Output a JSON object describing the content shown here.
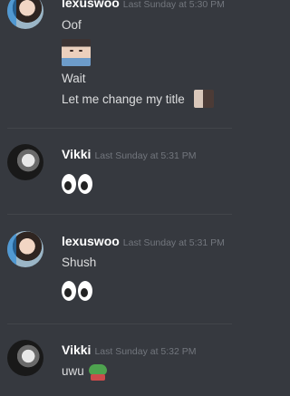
{
  "messages": [
    {
      "username": "lexuswoo",
      "timestamp": "Last Sunday at 5:30 PM",
      "lines": [
        "Oof",
        "Wait",
        "Let me change my title"
      ]
    },
    {
      "username": "Vikki",
      "timestamp": "Last Sunday at 5:31 PM",
      "emoji": "eyes-emoji"
    },
    {
      "username": "lexuswoo",
      "timestamp": "Last Sunday at 5:31 PM",
      "lines": [
        "Shush"
      ],
      "emoji": "eyes-emoji"
    },
    {
      "username": "Vikki",
      "timestamp": "Last Sunday at 5:32 PM",
      "lines": [
        "uwu"
      ]
    }
  ]
}
